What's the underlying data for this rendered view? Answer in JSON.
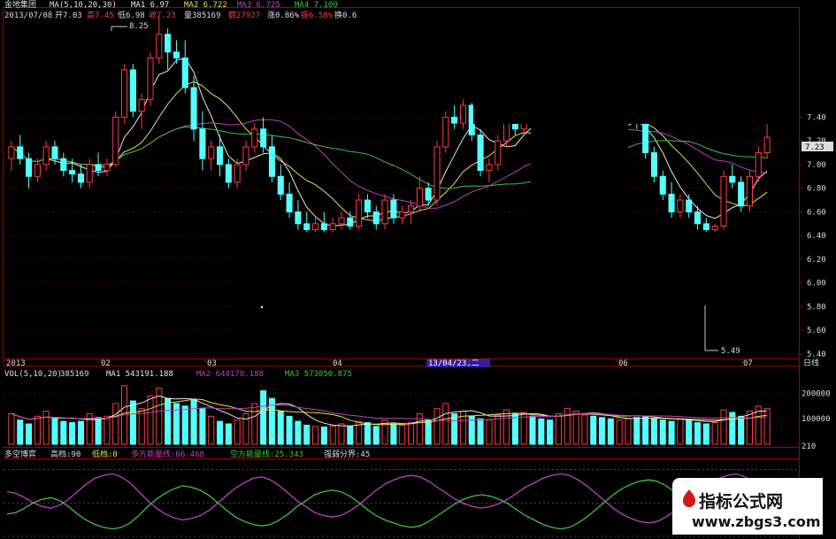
{
  "header": {
    "name": "金地集团",
    "ma_label": "MA(5,10,20,30)",
    "ma1": "MA1 6.97",
    "ma2": "MA2 6.722",
    "ma3": "MA3 6.725",
    "ma4": "MA4 7.100",
    "row2": [
      "2013/07/08",
      "开7.03",
      "高7.45",
      "低6.98",
      "收7.23",
      "量385169",
      "额27927",
      "涨0.86%",
      "振6.58%",
      "换0.6"
    ]
  },
  "price_axis": {
    "ticks": [
      "7.40",
      "7.20",
      "7.00",
      "6.80",
      "6.60",
      "6.40",
      "6.20",
      "6.00",
      "5.80",
      "5.60",
      "5.40"
    ],
    "current_badge": "7.23"
  },
  "annotations": {
    "high": "8.25",
    "low": "5.49"
  },
  "date_axis": {
    "ticks": [
      "2013",
      "02",
      "03",
      "04",
      "05",
      "06",
      "07"
    ],
    "cursor": "13/04/23,二",
    "period": "日线"
  },
  "volume_header": {
    "label": "VOL(5,10,20)",
    "value": "385169",
    "ma1": "MA1 543191.188",
    "ma2": "MA2 644170.188",
    "ma3": "MA3 573050.875"
  },
  "volume_axis": {
    "ticks": [
      "200000",
      "100000",
      "210"
    ]
  },
  "indicator_header": {
    "name": "多空博弈",
    "high": "高档:90",
    "low": "低档:0",
    "bull": "多方能量线:66.468",
    "bear": "空方能量线:25.343",
    "div": "强弱分界:45"
  },
  "watermark": {
    "title": "指标公式网",
    "url": "www.zbgs3.com"
  },
  "colors": {
    "up": "#ff3c3c",
    "down": "#54ffff",
    "ma_white": "#e8e8e8",
    "ma_yellow": "#e8e048",
    "ma_purple": "#c040c0",
    "ma_green": "#40c040",
    "grid": "#7a0000"
  },
  "chart_data": {
    "type": "candlestick",
    "y_range": [
      5.4,
      8.3
    ],
    "volume_range": [
      0,
      250000
    ],
    "indicator_range": [
      0,
      100
    ],
    "candles": [
      [
        7.05,
        7.2,
        6.95,
        7.15
      ],
      [
        7.15,
        7.25,
        7.0,
        7.05
      ],
      [
        7.05,
        7.1,
        6.8,
        6.9
      ],
      [
        6.9,
        7.05,
        6.85,
        7.0
      ],
      [
        7.0,
        7.2,
        6.95,
        7.15
      ],
      [
        7.15,
        7.2,
        7.0,
        7.05
      ],
      [
        7.05,
        7.1,
        6.9,
        6.95
      ],
      [
        6.95,
        7.05,
        6.85,
        6.92
      ],
      [
        6.92,
        7.0,
        6.8,
        6.85
      ],
      [
        6.85,
        7.05,
        6.8,
        7.0
      ],
      [
        7.0,
        7.1,
        6.9,
        6.95
      ],
      [
        6.95,
        7.05,
        6.9,
        7.0
      ],
      [
        7.0,
        7.45,
        6.98,
        7.4
      ],
      [
        7.4,
        7.85,
        7.35,
        7.8
      ],
      [
        7.8,
        7.85,
        7.4,
        7.45
      ],
      [
        7.45,
        7.6,
        7.3,
        7.55
      ],
      [
        7.55,
        7.95,
        7.5,
        7.9
      ],
      [
        7.9,
        8.25,
        7.85,
        8.1
      ],
      [
        8.1,
        8.15,
        7.8,
        7.95
      ],
      [
        7.95,
        8.05,
        7.85,
        7.9
      ],
      [
        7.9,
        8.05,
        7.6,
        7.65
      ],
      [
        7.65,
        7.75,
        7.2,
        7.3
      ],
      [
        7.3,
        7.45,
        6.95,
        7.05
      ],
      [
        7.05,
        7.2,
        6.95,
        7.15
      ],
      [
        7.15,
        7.25,
        6.9,
        7.0
      ],
      [
        7.0,
        7.05,
        6.8,
        6.85
      ],
      [
        6.85,
        7.05,
        6.8,
        7.0
      ],
      [
        7.0,
        7.2,
        6.95,
        7.15
      ],
      [
        7.15,
        7.35,
        7.1,
        7.3
      ],
      [
        7.3,
        7.4,
        7.1,
        7.15
      ],
      [
        7.15,
        7.25,
        6.85,
        6.9
      ],
      [
        6.9,
        7.0,
        6.7,
        6.75
      ],
      [
        6.75,
        6.85,
        6.55,
        6.6
      ],
      [
        6.6,
        6.7,
        6.45,
        6.5
      ],
      [
        6.5,
        6.6,
        6.4,
        6.45
      ],
      [
        6.45,
        6.55,
        6.4,
        6.5
      ],
      [
        6.5,
        6.6,
        6.4,
        6.45
      ],
      [
        6.45,
        6.55,
        6.4,
        6.5
      ],
      [
        6.5,
        6.6,
        6.45,
        6.55
      ],
      [
        6.55,
        6.6,
        6.45,
        6.48
      ],
      [
        6.48,
        6.75,
        6.45,
        6.7
      ],
      [
        6.7,
        6.75,
        6.55,
        6.6
      ],
      [
        6.6,
        6.65,
        6.45,
        6.5
      ],
      [
        6.5,
        6.75,
        6.45,
        6.7
      ],
      [
        6.7,
        6.75,
        6.5,
        6.55
      ],
      [
        6.55,
        6.65,
        6.5,
        6.6
      ],
      [
        6.6,
        6.7,
        6.5,
        6.65
      ],
      [
        6.65,
        6.9,
        6.6,
        6.8
      ],
      [
        6.8,
        6.85,
        6.65,
        6.7
      ],
      [
        6.7,
        7.2,
        6.65,
        7.15
      ],
      [
        7.15,
        7.45,
        7.1,
        7.4
      ],
      [
        7.4,
        7.5,
        7.3,
        7.35
      ],
      [
        7.35,
        7.55,
        7.3,
        7.5
      ],
      [
        7.5,
        7.52,
        7.2,
        7.25
      ],
      [
        7.25,
        7.3,
        6.9,
        6.95
      ],
      [
        6.95,
        7.05,
        6.85,
        7.0
      ],
      [
        7.0,
        7.25,
        6.95,
        7.2
      ],
      [
        7.2,
        7.4,
        7.15,
        7.35
      ],
      [
        7.35,
        7.45,
        7.25,
        7.3
      ],
      [
        7.3,
        7.45,
        7.25,
        7.4
      ],
      [
        7.4,
        7.5,
        7.3,
        7.35
      ],
      [
        7.35,
        7.45,
        7.25,
        7.3
      ],
      [
        7.3,
        7.35,
        7.0,
        7.05
      ],
      [
        7.05,
        7.25,
        7.0,
        7.2
      ],
      [
        7.2,
        7.4,
        7.15,
        7.35
      ],
      [
        7.35,
        7.45,
        7.3,
        7.4
      ],
      [
        7.4,
        7.48,
        7.35,
        7.42
      ],
      [
        7.42,
        7.48,
        7.35,
        7.4
      ],
      [
        7.4,
        7.45,
        7.35,
        7.38
      ],
      [
        7.38,
        7.45,
        7.3,
        7.35
      ],
      [
        7.35,
        7.42,
        7.3,
        7.38
      ],
      [
        7.38,
        7.45,
        7.35,
        7.4
      ],
      [
        7.4,
        7.45,
        7.3,
        7.35
      ],
      [
        7.35,
        7.4,
        7.05,
        7.1
      ],
      [
        7.1,
        7.15,
        6.85,
        6.9
      ],
      [
        6.9,
        6.95,
        6.7,
        6.75
      ],
      [
        6.75,
        6.85,
        6.55,
        6.6
      ],
      [
        6.6,
        6.75,
        6.55,
        6.7
      ],
      [
        6.7,
        6.75,
        6.55,
        6.6
      ],
      [
        6.6,
        6.65,
        6.45,
        6.5
      ],
      [
        6.5,
        6.55,
        6.4,
        6.45
      ],
      [
        6.45,
        6.5,
        6.4,
        6.48
      ],
      [
        6.48,
        6.95,
        6.45,
        6.9
      ],
      [
        6.9,
        7.0,
        6.8,
        6.85
      ],
      [
        6.85,
        6.9,
        6.6,
        6.65
      ],
      [
        6.65,
        6.95,
        6.6,
        6.9
      ],
      [
        6.9,
        7.15,
        6.85,
        7.1
      ],
      [
        7.1,
        7.45,
        7.05,
        7.23
      ]
    ],
    "volume": [
      120000,
      95000,
      80000,
      110000,
      130000,
      100000,
      90000,
      85000,
      90000,
      120000,
      105000,
      110000,
      160000,
      230000,
      170000,
      140000,
      190000,
      220000,
      180000,
      160000,
      150000,
      175000,
      140000,
      110000,
      90000,
      80000,
      95000,
      120000,
      160000,
      210000,
      180000,
      130000,
      110000,
      90000,
      75000,
      70000,
      68000,
      72000,
      80000,
      70000,
      90000,
      85000,
      70000,
      95000,
      80000,
      75000,
      85000,
      120000,
      95000,
      140000,
      160000,
      120000,
      130000,
      110000,
      100000,
      95000,
      115000,
      135000,
      120000,
      125000,
      110000,
      100000,
      95000,
      120000,
      140000,
      130000,
      115000,
      110000,
      105000,
      100000,
      95000,
      100000,
      105000,
      110000,
      100000,
      95000,
      90000,
      100000,
      95000,
      85000,
      80000,
      85000,
      135000,
      125000,
      110000,
      130000,
      150000,
      140000
    ],
    "bull_energy": [
      60,
      58,
      52,
      45,
      40,
      38,
      42,
      50,
      60,
      70,
      78,
      82,
      84,
      80,
      72,
      60,
      48,
      38,
      30,
      25,
      22,
      24,
      28,
      35,
      45,
      55,
      65,
      72,
      78,
      80,
      76,
      68,
      58,
      48,
      40,
      32,
      28,
      26,
      28,
      34,
      42,
      52,
      62,
      70,
      76,
      80,
      82,
      80,
      74,
      66,
      58,
      50,
      44,
      40,
      38,
      40,
      44,
      50,
      58,
      66,
      72,
      78,
      82,
      84,
      82,
      76,
      68,
      58,
      48,
      38,
      30,
      24,
      20,
      18,
      20,
      26,
      34,
      44,
      54,
      64,
      72,
      78,
      82,
      84,
      80,
      74,
      70,
      66
    ],
    "bear_energy": [
      30,
      32,
      38,
      45,
      50,
      52,
      48,
      40,
      30,
      22,
      16,
      12,
      10,
      12,
      18,
      28,
      40,
      50,
      58,
      64,
      68,
      66,
      62,
      55,
      45,
      35,
      26,
      20,
      16,
      14,
      16,
      22,
      30,
      40,
      48,
      56,
      60,
      62,
      60,
      54,
      46,
      36,
      28,
      22,
      18,
      14,
      12,
      14,
      20,
      28,
      36,
      44,
      50,
      54,
      56,
      54,
      50,
      44,
      36,
      28,
      22,
      16,
      12,
      10,
      12,
      18,
      26,
      36,
      46,
      56,
      64,
      70,
      74,
      76,
      74,
      68,
      60,
      50,
      40,
      30,
      22,
      16,
      12,
      10,
      14,
      20,
      24,
      25
    ]
  }
}
